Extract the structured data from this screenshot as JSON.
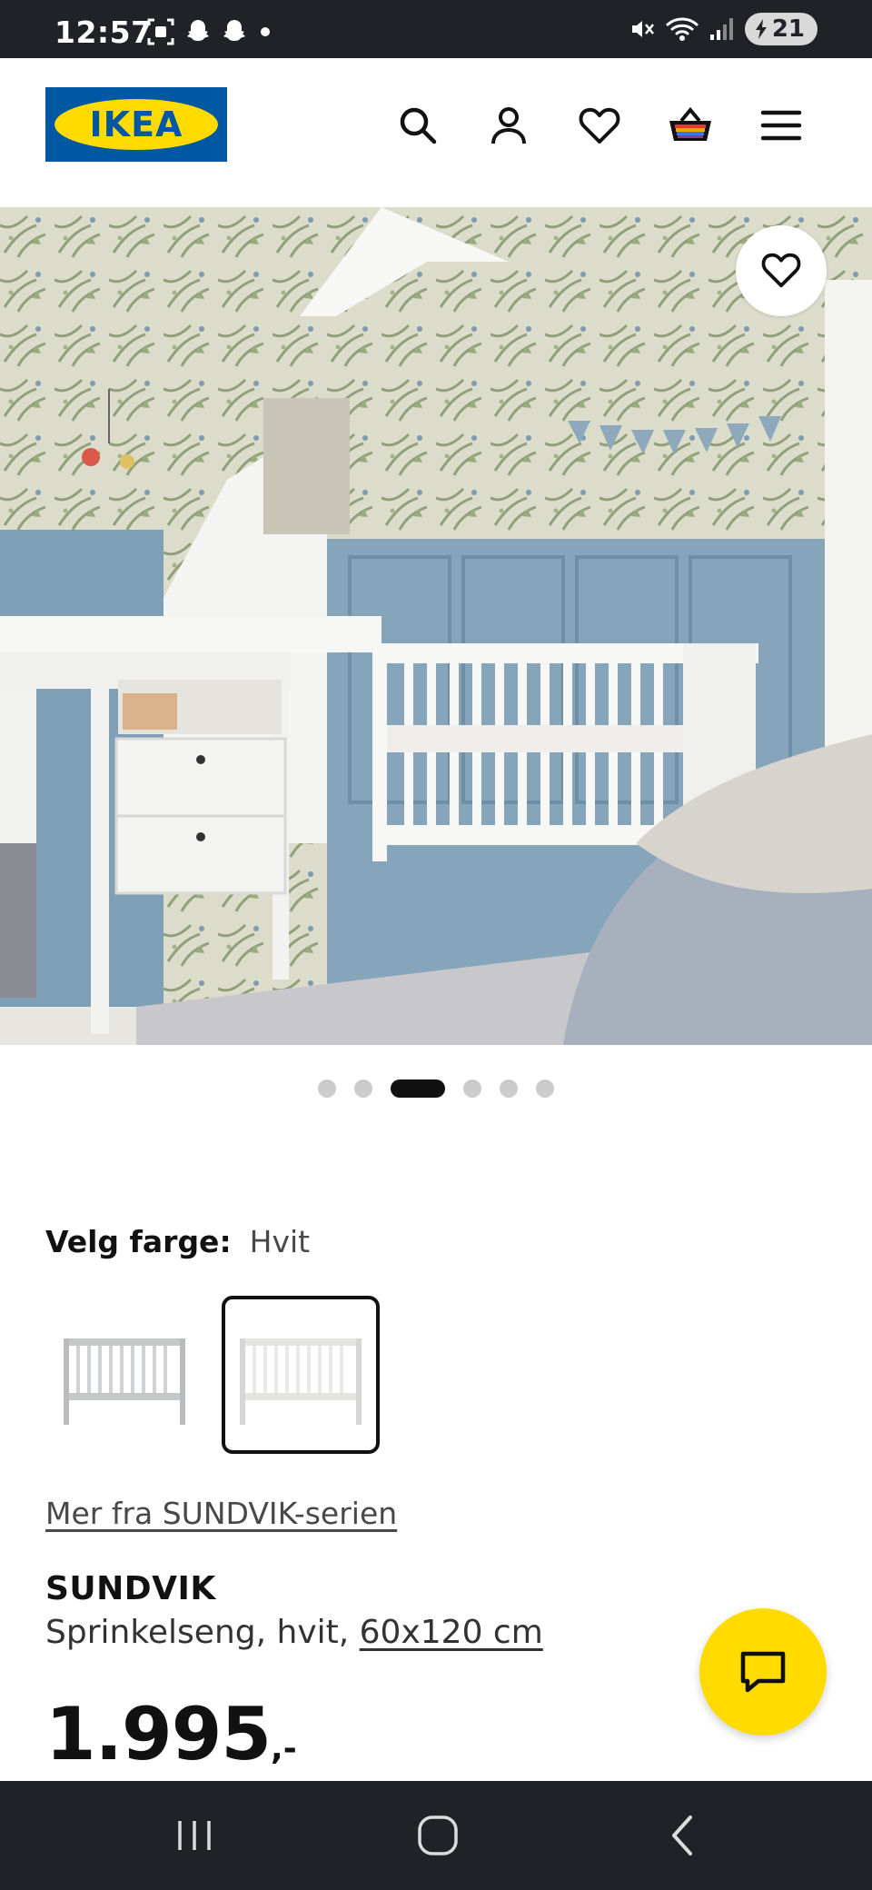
{
  "status_bar": {
    "time": "12:57",
    "battery_level": "21",
    "icons_left": [
      "screenshot-icon",
      "snapchat-icon",
      "snapchat-icon",
      "dot-icon"
    ],
    "icons_right": [
      "mute-icon",
      "wifi-icon",
      "signal-icon",
      "battery-charging-icon"
    ]
  },
  "header": {
    "logo_text": "IKEA",
    "icons": [
      "search-icon",
      "account-icon",
      "wishlist-heart-icon",
      "cart-basket-icon",
      "menu-hamburger-icon"
    ]
  },
  "hero": {
    "favorite_icon": "heart-outline-icon",
    "slides_total": 6,
    "active_slide": 3
  },
  "product": {
    "color_label": "Velg farge:",
    "color_value": "Hvit",
    "series_link": "Mer fra SUNDVIK-serien",
    "name": "SUNDVIK",
    "description": "Sprinkelseng, hvit,",
    "size": "60x120 cm",
    "price": "1.995",
    "price_suffix": ",-"
  },
  "colors": {
    "brand_blue": "#0058a3",
    "brand_yellow": "#ffdb00",
    "system_bar": "#202228"
  },
  "nav_bar": {
    "icons": [
      "recent-apps-icon",
      "home-icon",
      "back-icon"
    ]
  }
}
